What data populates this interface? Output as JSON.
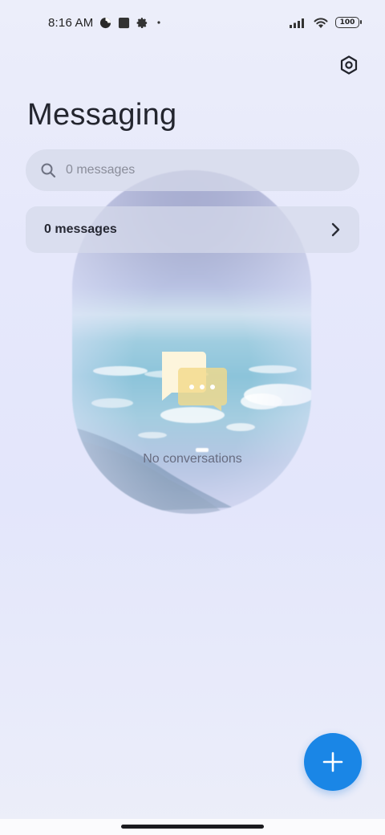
{
  "status_bar": {
    "time": "8:16 AM",
    "battery": "100",
    "icons": [
      "data-saver-icon",
      "app-notification-icon",
      "settings-gear-icon",
      "dot-icon",
      "signal-icon",
      "wifi-icon",
      "battery-icon"
    ]
  },
  "header": {
    "title": "Messaging",
    "settings_icon": "settings-icon"
  },
  "search": {
    "placeholder": "0 messages",
    "icon": "search-icon"
  },
  "summary": {
    "label": "0 messages",
    "icon": "chevron-right-icon"
  },
  "empty_state": {
    "text": "No conversations",
    "icon": "chat-bubbles-icon"
  },
  "fab": {
    "icon": "plus-icon",
    "color": "#1a86e6"
  }
}
